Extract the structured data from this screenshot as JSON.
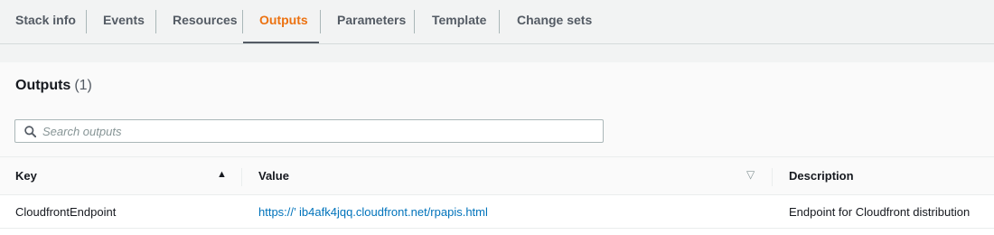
{
  "tabs": [
    {
      "label": "Stack info",
      "active": false
    },
    {
      "label": "Events",
      "active": false
    },
    {
      "label": "Resources",
      "active": false
    },
    {
      "label": "Outputs",
      "active": true
    },
    {
      "label": "Parameters",
      "active": false
    },
    {
      "label": "Template",
      "active": false
    },
    {
      "label": "Change sets",
      "active": false
    }
  ],
  "panel": {
    "title": "Outputs",
    "count": "(1)"
  },
  "search": {
    "placeholder": "Search outputs",
    "value": "",
    "icon": "search-icon"
  },
  "table": {
    "columns": [
      {
        "label": "Key",
        "sort": "ascending"
      },
      {
        "label": "Value",
        "sort": "none"
      },
      {
        "label": "Description",
        "sort": null
      }
    ],
    "rows": [
      {
        "key": "CloudfrontEndpoint",
        "value": "https://’     ib4afk4jqq.cloudfront.net/rpapis.html",
        "description": "Endpoint for Cloudfront distribution"
      }
    ]
  },
  "colors": {
    "active_tab": "#ec7211",
    "link": "#0073bb",
    "background": "#f2f3f3"
  }
}
